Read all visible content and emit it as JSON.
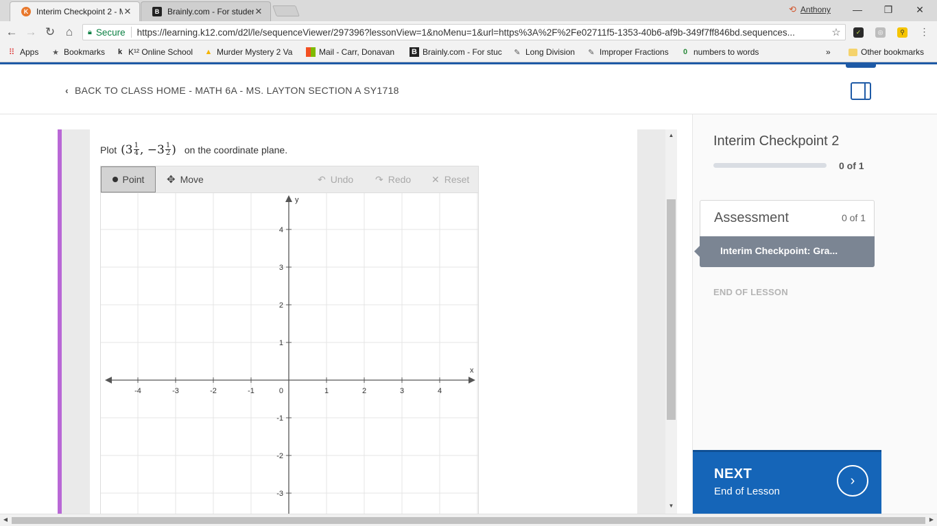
{
  "browser": {
    "tabs": [
      {
        "title": "Interim Checkpoint 2 - M",
        "favicon": "K"
      },
      {
        "title": "Brainly.com - For student",
        "favicon": "B"
      }
    ],
    "profile_name": "Anthony",
    "secure_label": "Secure",
    "url": "https://learning.k12.com/d2l/le/sequenceViewer/297396?lessonView=1&noMenu=1&url=https%3A%2F%2Fe02711f5-1353-40b6-af9b-349f7ff846bd.sequences..."
  },
  "bookmarks": {
    "apps": "Apps",
    "items": [
      {
        "label": "Bookmarks",
        "icon": "star-icon"
      },
      {
        "label": "K¹² Online School",
        "icon": "k12-icon"
      },
      {
        "label": "Murder Mystery 2 Va",
        "icon": "drive-icon"
      },
      {
        "label": "Mail - Carr, Donavan",
        "icon": "office-icon"
      },
      {
        "label": "Brainly.com - For stuc",
        "icon": "brainly-icon"
      },
      {
        "label": "Long Division",
        "icon": "page-icon"
      },
      {
        "label": "Improper Fractions",
        "icon": "page-icon"
      },
      {
        "label": "numbers to words",
        "icon": "page-icon"
      }
    ],
    "overflow": "»",
    "other": "Other bookmarks"
  },
  "header": {
    "back_link": "BACK TO CLASS HOME - MATH 6A - MS. LAYTON SECTION A SY1718"
  },
  "question": {
    "prefix": "Plot",
    "point_whole_x": "3",
    "point_frac_x_num": "1",
    "point_frac_x_den": "4",
    "point_whole_y": "−3",
    "point_frac_y_num": "1",
    "point_frac_y_den": "2",
    "suffix": "on the coordinate plane."
  },
  "graph_tools": {
    "point": "Point",
    "move": "Move",
    "undo": "Undo",
    "redo": "Redo",
    "reset": "Reset"
  },
  "chart_data": {
    "type": "scatter",
    "xlabel": "x",
    "ylabel": "y",
    "xlim": [
      -4.5,
      4.5
    ],
    "ylim": [
      -3.5,
      4.5
    ],
    "x_ticks": [
      "-4",
      "-3",
      "-2",
      "-1",
      "1",
      "2",
      "3",
      "4"
    ],
    "y_ticks": [
      "4",
      "3",
      "2",
      "1",
      "-1",
      "-2",
      "-3"
    ],
    "origin_label": "0",
    "grid": true,
    "series": []
  },
  "side": {
    "title": "Interim Checkpoint 2",
    "progress_fraction": 0,
    "progress_text": "0 of 1",
    "assessment_title": "Assessment",
    "assessment_count": "0 of 1",
    "assessment_item": "Interim Checkpoint: Gra...",
    "end_of_lesson": "END OF LESSON",
    "next_label": "NEXT",
    "next_sub": "End of Lesson"
  },
  "colors": {
    "accent_blue": "#1565b8",
    "purple_bar": "#b968d6"
  }
}
